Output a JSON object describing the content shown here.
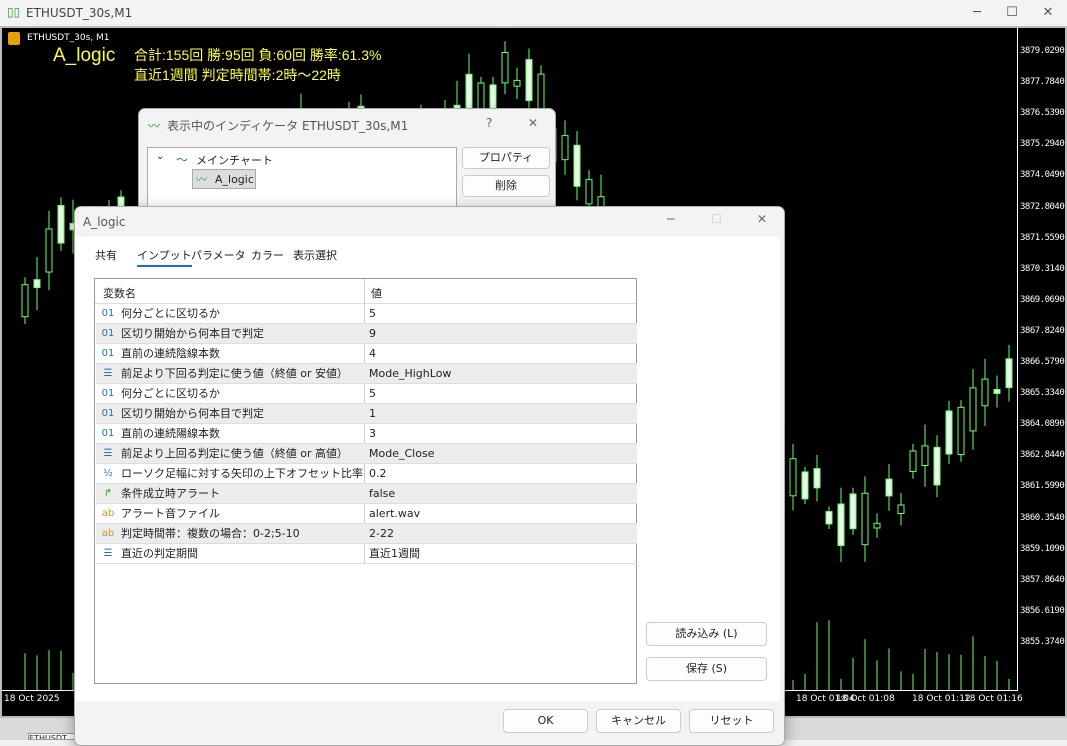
{
  "window": {
    "title": "ETHUSDT_30s,M1",
    "controls": [
      "─",
      "☐",
      "✕"
    ]
  },
  "chart": {
    "symbol_label": "ETHUSDT_30s, M1",
    "indicator_name": "A_logic",
    "stats_line": "合計:155回 勝:95回 負:60回 勝率:61.3%",
    "period_line": "直近1週間 判定時間帯:2時～22時",
    "candle_color": "#6cff6c",
    "price_labels": [
      "3879.0290",
      "3877.7840",
      "3876.5390",
      "3875.2940",
      "3874.0490",
      "3872.8040",
      "3871.5590",
      "3870.3140",
      "3869.0690",
      "3867.8240",
      "3866.5790",
      "3865.3340",
      "3864.0890",
      "3862.8440",
      "3861.5990",
      "3860.3540",
      "3859.1090",
      "3857.8640",
      "3856.6190",
      "3855.3740"
    ],
    "time_labels": [
      "18 Oct 2025",
      "18 Oct 01:04",
      "18 Oct 01:08",
      "18 Oct 01:12",
      "18 Oct 01:16"
    ],
    "bottom_tab": "ETHUSDT"
  },
  "indicator_dialog": {
    "title": "表示中のインディケータ ETHUSDT_30s,M1",
    "help": "?",
    "close": "✕",
    "tree_root": "メインチャート",
    "tree_child": "A_logic",
    "properties_button": "プロパティ",
    "delete_button": "削除"
  },
  "main_dialog": {
    "title": "A_logic",
    "controls": [
      "─",
      "☐",
      "✕"
    ],
    "tabs": [
      "共有",
      "インプット",
      "パラメータ",
      "カラー",
      "表示選択"
    ],
    "active_tab": "インプット",
    "columns": [
      "変数名",
      "値"
    ],
    "rows": [
      {
        "icon": "01",
        "type": "int",
        "name": "何分ごとに区切るか",
        "value": "5"
      },
      {
        "icon": "01",
        "type": "int",
        "name": "区切り開始から何本目で判定",
        "value": "9"
      },
      {
        "icon": "01",
        "type": "int",
        "name": "直前の連続陰線本数",
        "value": "4"
      },
      {
        "icon": "☰",
        "type": "enum",
        "name": "前足より下回る判定に使う値（終値 or 安値）",
        "value": "Mode_HighLow"
      },
      {
        "icon": "01",
        "type": "int",
        "name": "何分ごとに区切るか",
        "value": "5"
      },
      {
        "icon": "01",
        "type": "int",
        "name": "区切り開始から何本目で判定",
        "value": "1"
      },
      {
        "icon": "01",
        "type": "int",
        "name": "直前の連続陽線本数",
        "value": "3"
      },
      {
        "icon": "☰",
        "type": "enum",
        "name": "前足より上回る判定に使う値（終値 or 高値）",
        "value": "Mode_Close"
      },
      {
        "icon": "½",
        "type": "double",
        "name": "ローソク足幅に対する矢印の上下オフセット比率",
        "value": "0.2"
      },
      {
        "icon": "↱",
        "type": "bool",
        "name": "条件成立時アラート",
        "value": "false"
      },
      {
        "icon": "ab",
        "type": "string",
        "name": "アラート音ファイル",
        "value": "alert.wav"
      },
      {
        "icon": "ab",
        "type": "string",
        "name": "判定時間帯：複数の場合：0-2;5-10",
        "value": "2-22"
      },
      {
        "icon": "☰",
        "type": "enum",
        "name": "直近の判定期間",
        "value": "直近1週間"
      }
    ],
    "icon_colors": {
      "int": "#2a6fb0",
      "enum": "#2a6fb0",
      "double": "#2a6fb0",
      "bool": "#2a9a2a",
      "string": "#c8962a"
    },
    "load_button": "読み込み (L)",
    "save_button": "保存 (S)",
    "ok_button": "OK",
    "cancel_button": "キャンセル",
    "reset_button": "リセット"
  }
}
